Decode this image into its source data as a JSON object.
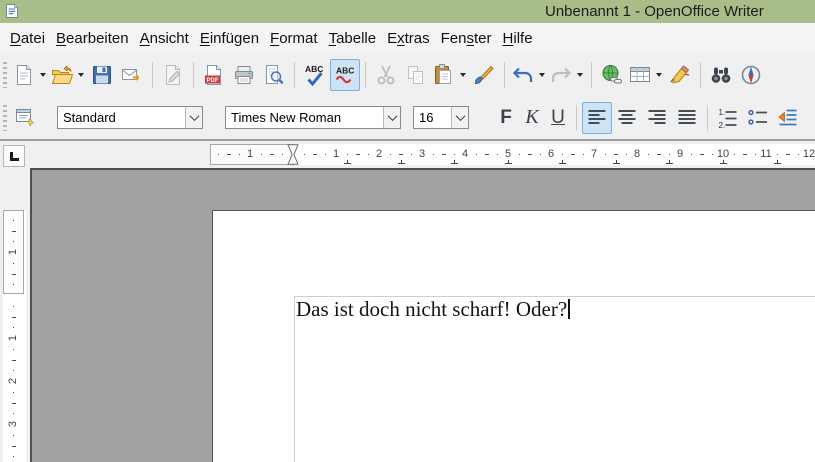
{
  "window": {
    "title": "Unbenannt 1 - OpenOffice Writer",
    "app_icon": "writer-document"
  },
  "menu": {
    "items": [
      {
        "id": "datei",
        "pre": "",
        "key": "D",
        "post": "atei"
      },
      {
        "id": "bearbeiten",
        "pre": "",
        "key": "B",
        "post": "earbeiten"
      },
      {
        "id": "ansicht",
        "pre": "",
        "key": "A",
        "post": "nsicht"
      },
      {
        "id": "einfuegen",
        "pre": "",
        "key": "E",
        "post": "infügen"
      },
      {
        "id": "format",
        "pre": "",
        "key": "F",
        "post": "ormat"
      },
      {
        "id": "tabelle",
        "pre": "",
        "key": "T",
        "post": "abelle"
      },
      {
        "id": "extras",
        "pre": "E",
        "key": "x",
        "post": "tras"
      },
      {
        "id": "fenster",
        "pre": "Fen",
        "key": "s",
        "post": "ter"
      },
      {
        "id": "hilfe",
        "pre": "",
        "key": "H",
        "post": "ilfe"
      }
    ]
  },
  "toolbar_standard": {
    "items": [
      {
        "name": "new-document",
        "dropdown": true
      },
      {
        "name": "open",
        "dropdown": true
      },
      {
        "name": "save"
      },
      {
        "name": "email"
      },
      {
        "sep": true
      },
      {
        "name": "edit-file",
        "disabled": true
      },
      {
        "sep": true
      },
      {
        "name": "export-pdf"
      },
      {
        "name": "print"
      },
      {
        "name": "page-preview"
      },
      {
        "sep": true
      },
      {
        "name": "spellcheck"
      },
      {
        "name": "auto-spellcheck",
        "active": true
      },
      {
        "sep": true
      },
      {
        "name": "cut",
        "disabled": true
      },
      {
        "name": "copy",
        "disabled": true
      },
      {
        "name": "paste",
        "dropdown": true
      },
      {
        "name": "format-paintbrush"
      },
      {
        "sep": true
      },
      {
        "name": "undo",
        "dropdown": true
      },
      {
        "name": "redo",
        "disabled": true,
        "dropdown": true
      },
      {
        "sep": true
      },
      {
        "name": "hyperlink"
      },
      {
        "name": "table",
        "dropdown": true
      },
      {
        "name": "draw-functions"
      },
      {
        "sep": true
      },
      {
        "name": "find-replace"
      },
      {
        "name": "navigator"
      }
    ]
  },
  "toolbar_format": {
    "paragraph_style": {
      "value": "Standard"
    },
    "font_name": {
      "value": "Times New Roman"
    },
    "font_size": {
      "value": "16"
    },
    "bold_label": "F",
    "italic_label": "K",
    "underline_label": "U",
    "items": [
      {
        "sep": true
      },
      {
        "name": "align-left",
        "active": true
      },
      {
        "name": "align-center"
      },
      {
        "name": "align-right"
      },
      {
        "name": "justify"
      },
      {
        "sep": true
      },
      {
        "name": "numbered-list"
      },
      {
        "name": "bullet-list"
      },
      {
        "name": "decrease-indent"
      }
    ]
  },
  "ruler": {
    "h_labels": [
      "1",
      "1",
      "2",
      "3",
      "4",
      "5",
      "6",
      "7",
      "8",
      "9",
      "10",
      "11",
      "12"
    ],
    "v_labels": [
      "1",
      "1",
      "2",
      "3"
    ]
  },
  "document": {
    "text": "Das ist doch nicht scharf! Oder?"
  },
  "colors": {
    "titlebar": "#a9bd88",
    "active_toggle_bg": "#cfe3f7",
    "active_toggle_border": "#7fb0e0",
    "canvas": "#a2a2a2",
    "page": "#ffffff",
    "text_boundary": "#ccd0d4"
  }
}
